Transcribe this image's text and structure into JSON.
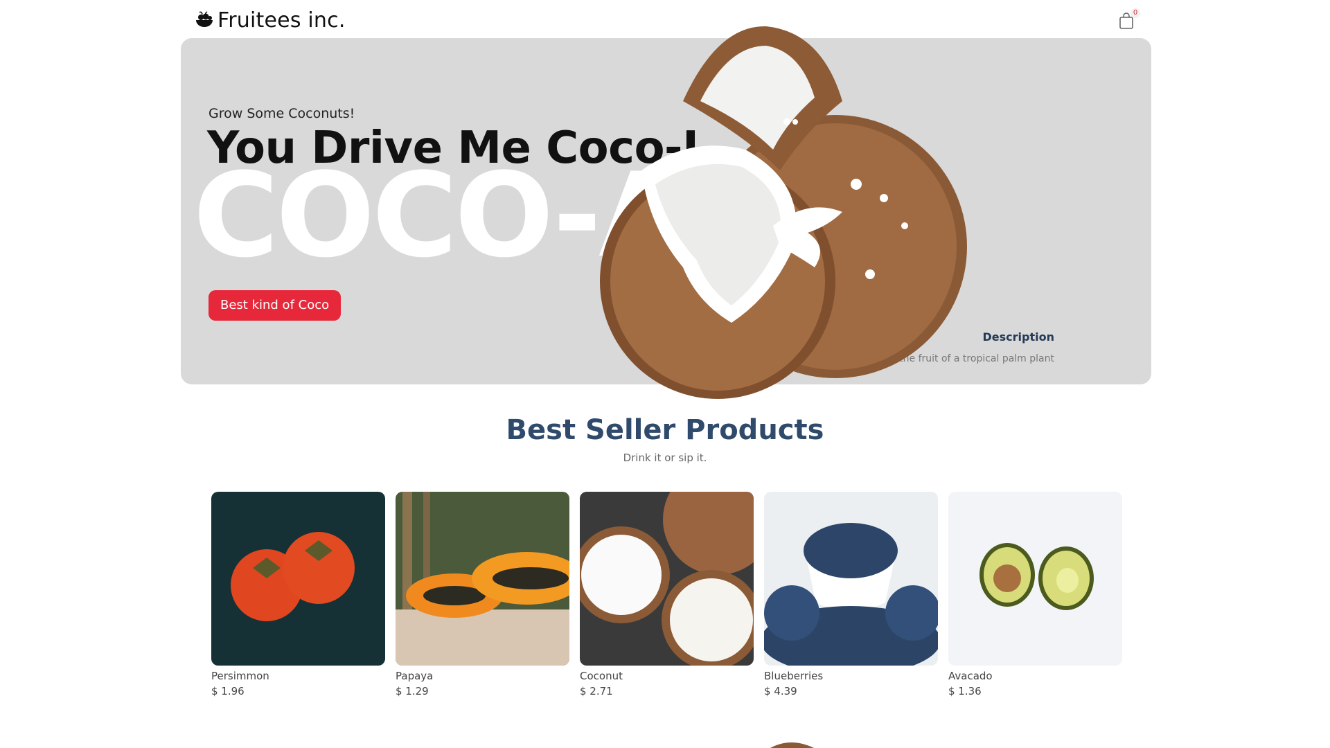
{
  "header": {
    "logo_text": "Fruitees inc.",
    "cart_count": "0"
  },
  "hero": {
    "subtitle": "Grow Some Coconuts!",
    "title": "You Drive Me Coco-I",
    "big_text": "COCO-A",
    "button_label": "Best kind of Coco",
    "description_label": "Description",
    "description_text": "is the fruit of a tropical palm plant"
  },
  "best_seller": {
    "title": "Best Seller Products",
    "subtitle": "Drink it or sip it."
  },
  "products": [
    {
      "name": "Persimmon",
      "price": "$ 1.96"
    },
    {
      "name": "Papaya",
      "price": "$ 1.29"
    },
    {
      "name": "Coconut",
      "price": "$ 2.71"
    },
    {
      "name": "Blueberries",
      "price": "$ 4.39"
    },
    {
      "name": "Avacado",
      "price": "$ 1.36"
    }
  ],
  "colors": {
    "hero_bg": "#d9d9d9",
    "accent_button": "#e7283b",
    "heading_blue": "#2f4a6a"
  },
  "icons": {
    "logo": "fruit-bowl-icon",
    "cart": "shopping-bag-icon"
  }
}
